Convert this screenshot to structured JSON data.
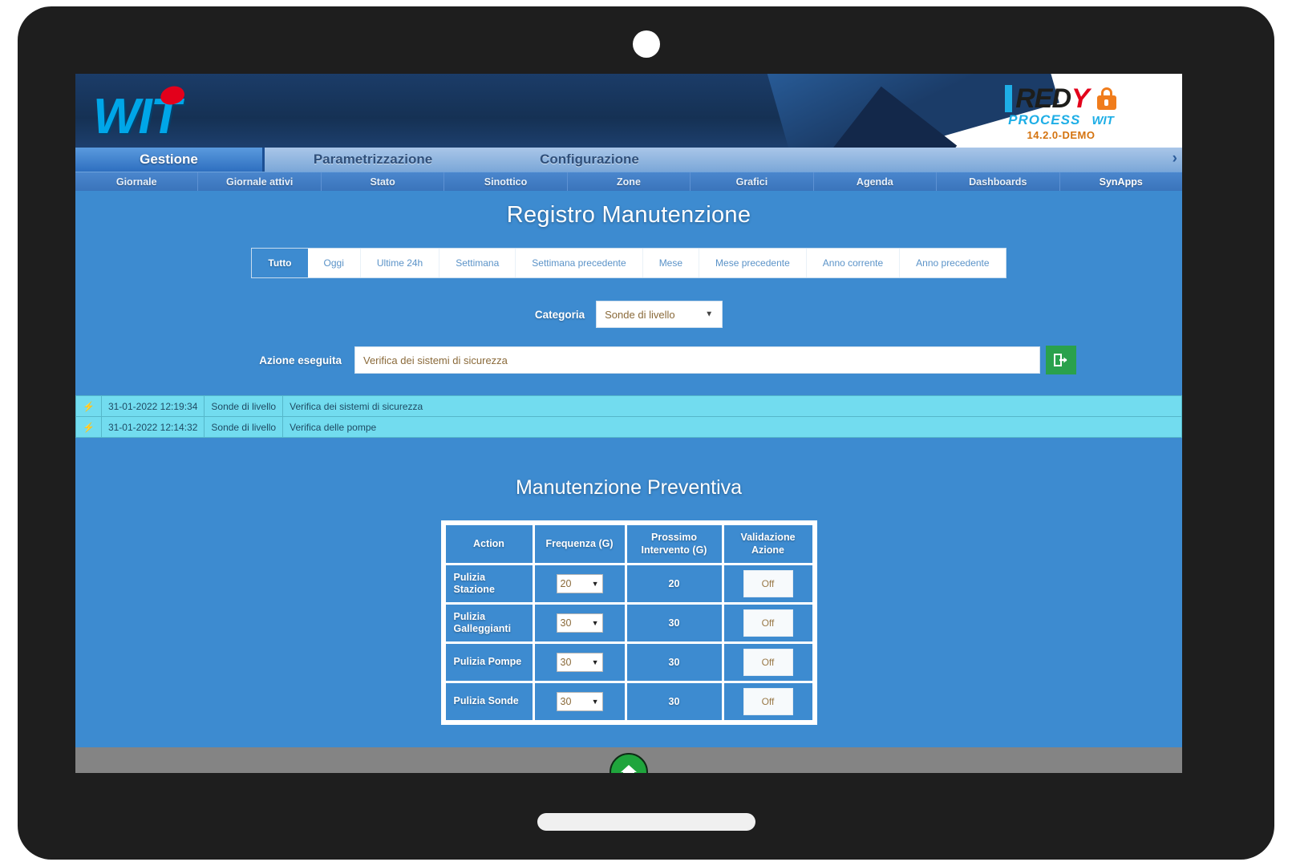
{
  "brand": {
    "wit_logo_text": "WIT",
    "redy_name": "RED",
    "redy_y": "Y",
    "redy_process": "PROCESS",
    "redy_mini_wit": "WIT",
    "version": "14.2.0-DEMO"
  },
  "main_tabs": [
    {
      "label": "Gestione",
      "active": true
    },
    {
      "label": "Parametrizzazione",
      "active": false
    },
    {
      "label": "Configurazione",
      "active": false
    }
  ],
  "main_tabs_overflow": "›",
  "sub_nav": [
    {
      "label": "Giornale"
    },
    {
      "label": "Giornale attivi"
    },
    {
      "label": "Stato"
    },
    {
      "label": "Sinottico"
    },
    {
      "label": "Zone"
    },
    {
      "label": "Grafici"
    },
    {
      "label": "Agenda"
    },
    {
      "label": "Dashboards"
    },
    {
      "label": "SynApps"
    }
  ],
  "page": {
    "title": "Registro Manutenzione"
  },
  "period_filter": {
    "items": [
      {
        "label": "Tutto",
        "active": true
      },
      {
        "label": "Oggi",
        "active": false
      },
      {
        "label": "Ultime 24h",
        "active": false
      },
      {
        "label": "Settimana",
        "active": false
      },
      {
        "label": "Settimana precedente",
        "active": false
      },
      {
        "label": "Mese",
        "active": false
      },
      {
        "label": "Mese precedente",
        "active": false
      },
      {
        "label": "Anno corrente",
        "active": false
      },
      {
        "label": "Anno precedente",
        "active": false
      }
    ]
  },
  "categoria": {
    "label": "Categoria",
    "value": "Sonde di livello",
    "caret": "▼"
  },
  "azione": {
    "label": "Azione eseguita",
    "value": "Verifica dei sistemi di sicurezza",
    "placeholder": "",
    "submit_icon": "save-enter-icon"
  },
  "log_rows": [
    {
      "icon": "⚡",
      "timestamp": "31-01-2022 12:19:34",
      "categoria": "Sonde di livello",
      "azione": "Verifica dei sistemi di sicurezza"
    },
    {
      "icon": "⚡",
      "timestamp": "31-01-2022 12:14:32",
      "categoria": "Sonde di livello",
      "azione": "Verifica delle pompe"
    }
  ],
  "preventiva": {
    "title": "Manutenzione Preventiva",
    "headers": {
      "action": "Action",
      "frequenza": "Frequenza (G)",
      "prossimo": "Prossimo Intervento (G)",
      "validazione": "Validazione Azione"
    },
    "rows": [
      {
        "action": "Pulizia Stazione",
        "frequenza": "20",
        "prossimo": "20",
        "validazione": "Off"
      },
      {
        "action": "Pulizia Galleggianti",
        "frequenza": "30",
        "prossimo": "30",
        "validazione": "Off"
      },
      {
        "action": "Pulizia Pompe",
        "frequenza": "30",
        "prossimo": "30",
        "validazione": "Off"
      },
      {
        "action": "Pulizia Sonde",
        "frequenza": "30",
        "prossimo": "30",
        "validazione": "Off"
      }
    ],
    "caret": "▼"
  },
  "footer": {
    "home_icon": "home-icon"
  },
  "colors": {
    "page_bg": "#3d8bd0",
    "header_blue": "#1b3c68",
    "log_row": "#72dcef",
    "accent_green": "#2aa14c",
    "brand_cyan": "#00a6e8",
    "brand_red": "#e3001b",
    "lock_orange": "#f07c1c"
  }
}
